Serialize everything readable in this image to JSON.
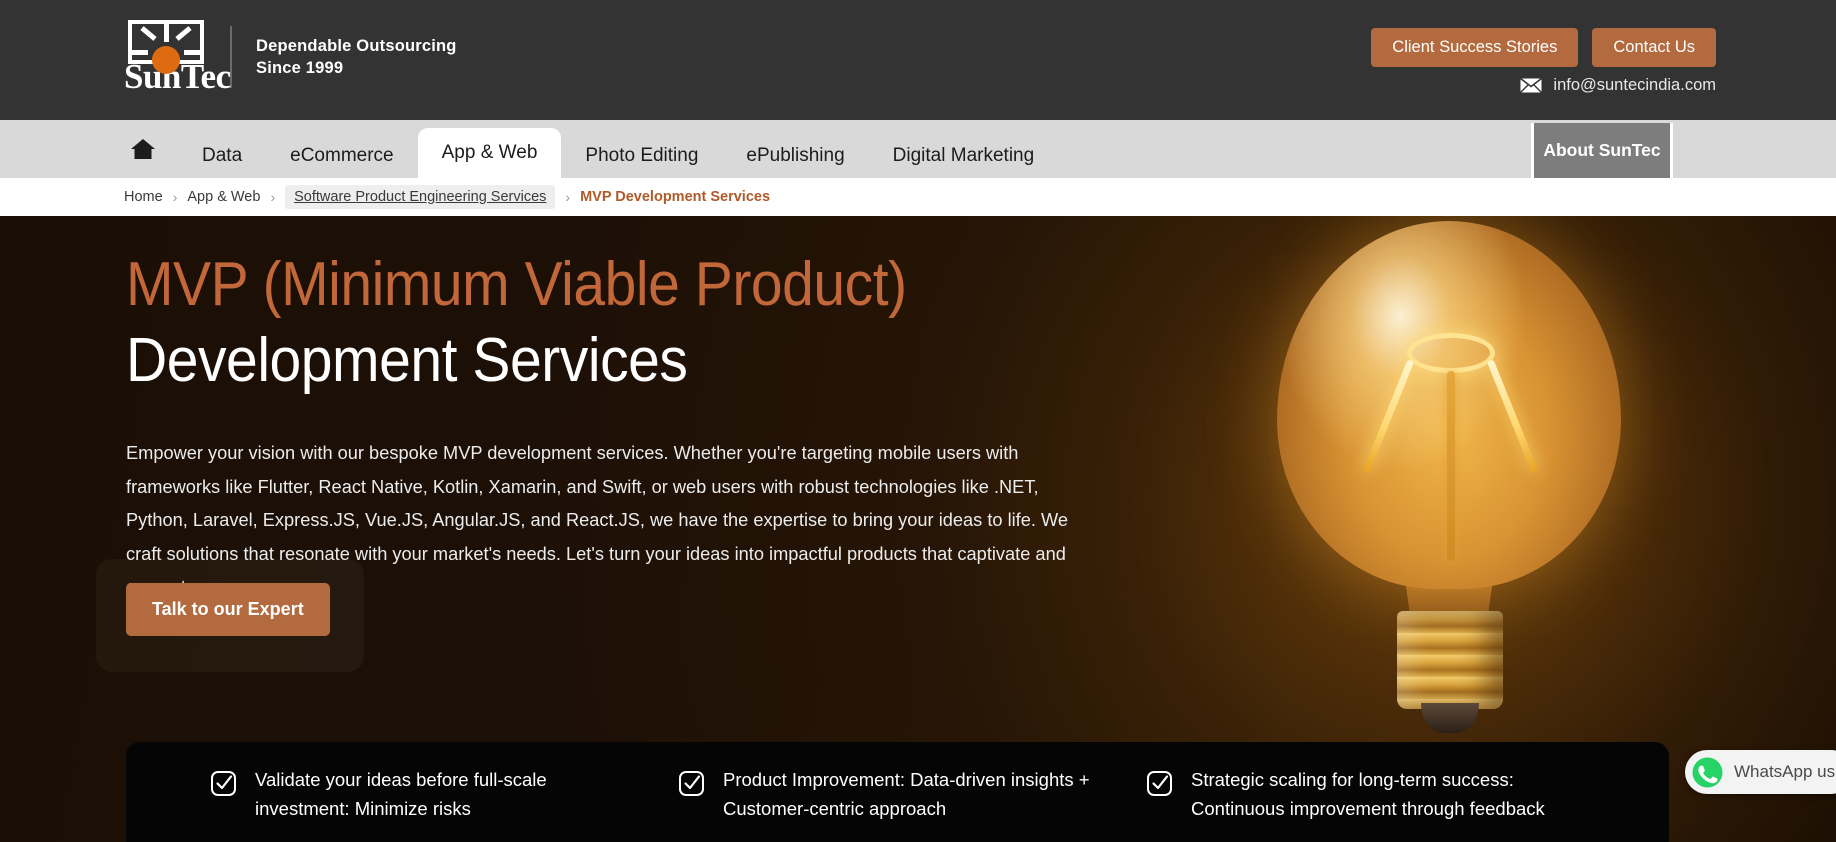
{
  "header": {
    "logo_name": "SunTec",
    "tagline_line1": "Dependable Outsourcing",
    "tagline_line2": "Since 1999",
    "buttons": [
      {
        "label": "Client Success Stories"
      },
      {
        "label": "Contact Us"
      }
    ],
    "email": "info@suntecindia.com",
    "email_icon": "envelope-icon",
    "accent_color": "#b26a3e",
    "background_color": "#333333"
  },
  "nav": {
    "home_icon": "home-icon",
    "items": [
      {
        "label": "Data",
        "active": false
      },
      {
        "label": "eCommerce",
        "active": false
      },
      {
        "label": "App & Web",
        "active": true
      },
      {
        "label": "Photo Editing",
        "active": false
      },
      {
        "label": "ePublishing",
        "active": false
      },
      {
        "label": "Digital Marketing",
        "active": false
      }
    ],
    "about_tab": "About SunTec",
    "background_color": "#d9d9d9"
  },
  "breadcrumb": {
    "items": [
      {
        "label": "Home",
        "style": "plain"
      },
      {
        "label": "App & Web",
        "style": "plain"
      },
      {
        "label": "Software Product Engineering Services",
        "style": "highlighted"
      },
      {
        "label": "MVP Development Services",
        "style": "current"
      }
    ],
    "separator": "›",
    "current_color": "#b05a2a"
  },
  "hero": {
    "heading_line1": "MVP (Minimum Viable Product)",
    "heading_line2": "Development Services",
    "heading_line1_color": "#c2673a",
    "paragraph": "Empower your vision with our bespoke MVP development services. Whether you're targeting mobile users with frameworks like Flutter, React Native, Kotlin, Xamarin, and Swift, or web users with robust technologies like .NET, Python, Laravel, Express.JS, Vue.JS, Angular.JS, and React.JS, we have the expertise to bring your ideas to life. We craft solutions that resonate with your market's needs. Let's turn your ideas into impactful products that captivate and convert.",
    "cta_label": "Talk to our Expert",
    "image_alt": "glowing-lightbulb-image",
    "background_color": "#1b0f05"
  },
  "features": {
    "icon": "check-square-icon",
    "items": [
      {
        "text": "Validate your ideas before full-scale investment: Minimize risks"
      },
      {
        "text": "Product Improvement: Data-driven insights + Customer-centric approach"
      },
      {
        "text": "Strategic scaling for long-term success: Continuous improvement through feedback"
      }
    ],
    "background_color": "#050505"
  },
  "whatsapp_widget": {
    "label": "WhatsApp us",
    "icon": "whatsapp-icon",
    "icon_color": "#25D366"
  }
}
